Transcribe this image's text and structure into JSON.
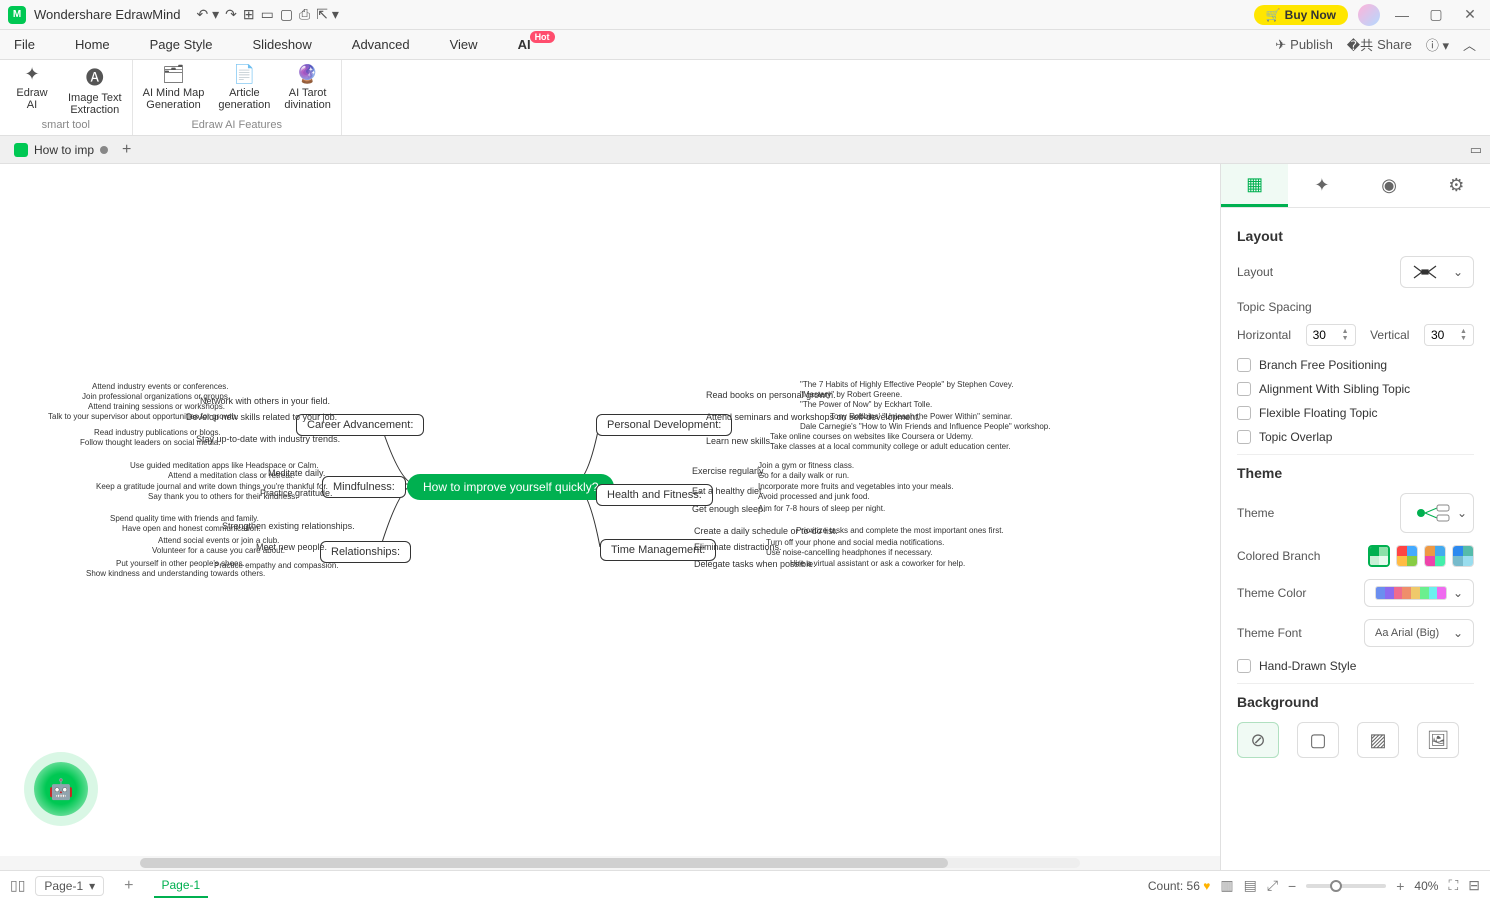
{
  "app": {
    "title": "Wondershare EdrawMind"
  },
  "titlebar": {
    "buy": "Buy Now"
  },
  "menu": {
    "items": [
      "File",
      "Home",
      "Page Style",
      "Slideshow",
      "Advanced",
      "View",
      "AI"
    ],
    "hot": "Hot",
    "publish": "Publish",
    "share": "Share"
  },
  "ribbon": {
    "g1": {
      "btn1": "Edraw\nAI",
      "btn2": "Image Text\nExtraction",
      "caption": "smart tool"
    },
    "g2": {
      "btn1": "AI Mind Map\nGeneration",
      "btn2": "Article\ngeneration",
      "btn3": "AI Tarot\ndivination",
      "caption": "Edraw AI Features"
    }
  },
  "doctab": {
    "name": "How to imp"
  },
  "mindmap": {
    "central": "How to improve yourself quickly?",
    "left": [
      {
        "title": "Career Advancement:",
        "subs": [
          {
            "t": "Network with others in your field.",
            "leaves": [
              "Attend industry events or conferences.",
              "Join professional organizations or groups.",
              "Attend training sessions or workshops."
            ]
          },
          {
            "t": "Develop new skills related to your job.",
            "leaves": [
              "Talk to your supervisor about opportunities for growth."
            ]
          },
          {
            "t": "Stay up-to-date with industry trends.",
            "leaves": [
              "Read industry publications or blogs.",
              "Follow thought leaders on social media."
            ]
          }
        ]
      },
      {
        "title": "Mindfulness:",
        "subs": [
          {
            "t": "Meditate daily.",
            "leaves": [
              "Use guided meditation apps like Headspace or Calm.",
              "Attend a meditation class or retreat."
            ]
          },
          {
            "t": "Practice gratitude.",
            "leaves": [
              "Keep a gratitude journal and write down things you're thankful for.",
              "Say thank you to others for their kindness."
            ]
          }
        ]
      },
      {
        "title": "Relationships:",
        "subs": [
          {
            "t": "Strengthen existing relationships.",
            "leaves": [
              "Spend quality time with friends and family.",
              "Have open and honest communication."
            ]
          },
          {
            "t": "Meet new people.",
            "leaves": [
              "Attend social events or join a club.",
              "Volunteer for a cause you care about."
            ]
          },
          {
            "t": "",
            "leaves": [
              "Put yourself in other people's shoes.",
              "Practice empathy and compassion.",
              "Show kindness and understanding towards others."
            ]
          }
        ]
      }
    ],
    "right": [
      {
        "title": "Personal Development:",
        "subs": [
          {
            "t": "Read books on personal growth.",
            "leaves": [
              "\"The 7 Habits of Highly Effective People\" by Stephen Covey.",
              "\"Mastery\" by Robert Greene.",
              "\"The Power of Now\" by Eckhart Tolle."
            ]
          },
          {
            "t": "Attend seminars and workshops on self-development.",
            "leaves": [
              "Tony Robbins' \"Unleash the Power Within\" seminar.",
              "Dale Carnegie's \"How to Win Friends and Influence People\" workshop."
            ]
          },
          {
            "t": "Learn new skills.",
            "leaves": [
              "Take online courses on websites like Coursera or Udemy.",
              "Take classes at a local community college or adult education center."
            ]
          }
        ]
      },
      {
        "title": "Health and Fitness:",
        "subs": [
          {
            "t": "Exercise regularly.",
            "leaves": [
              "Join a gym or fitness class.",
              "Go for a daily walk or run."
            ]
          },
          {
            "t": "Eat a healthy diet.",
            "leaves": [
              "Incorporate more fruits and vegetables into your meals.",
              "Avoid processed and junk food."
            ]
          },
          {
            "t": "Get enough sleep.",
            "leaves": [
              "Aim for 7-8 hours of sleep per night."
            ]
          }
        ]
      },
      {
        "title": "Time Management:",
        "subs": [
          {
            "t": "Create a daily schedule or to-do list.",
            "leaves": [
              "Prioritize tasks and complete the most important ones first."
            ]
          },
          {
            "t": "Eliminate distractions.",
            "leaves": [
              "Turn off your phone and social media notifications.",
              "Use noise-cancelling headphones if necessary."
            ]
          },
          {
            "t": "Delegate tasks when possible.",
            "leaves": [
              "Hire a virtual assistant or ask a coworker for help."
            ]
          }
        ]
      }
    ]
  },
  "rpanel": {
    "layout_title": "Layout",
    "layout_label": "Layout",
    "topic_spacing": "Topic Spacing",
    "horizontal": "Horizontal",
    "h_val": "30",
    "vertical": "Vertical",
    "v_val": "30",
    "chk1": "Branch Free Positioning",
    "chk2": "Alignment With Sibling Topic",
    "chk3": "Flexible Floating Topic",
    "chk4": "Topic Overlap",
    "theme_title": "Theme",
    "theme_label": "Theme",
    "colored_branch": "Colored Branch",
    "theme_color": "Theme Color",
    "theme_font": "Theme Font",
    "font_val": "Arial (Big)",
    "hand_drawn": "Hand-Drawn Style",
    "background_title": "Background"
  },
  "bottom": {
    "page_sel": "Page-1",
    "page_chip": "Page-1",
    "count": "Count: 56",
    "zoom": "40%"
  }
}
